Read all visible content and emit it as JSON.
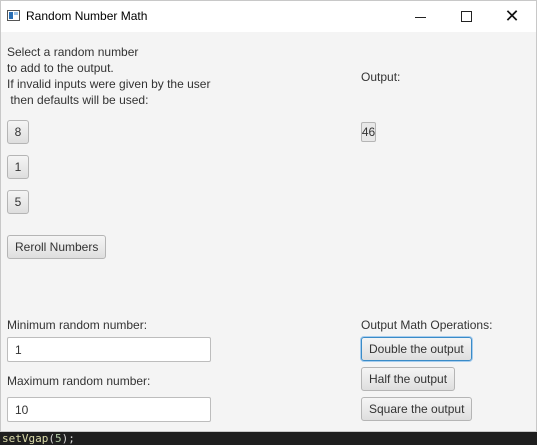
{
  "window": {
    "title": "Random Number Math",
    "controls": {
      "minimize": "",
      "maximize": "",
      "close": "✕"
    }
  },
  "left_panel": {
    "instructions": "Select a random number\nto add to the output.\nIf invalid inputs were given by the user\n then defaults will be used:",
    "number_buttons": [
      "8",
      "1",
      "5"
    ],
    "reroll_label": "Reroll Numbers",
    "min_label": "Minimum random number:",
    "min_value": "1",
    "max_label": "Maximum random number:",
    "max_value": "10"
  },
  "right_panel": {
    "output_label": "Output:",
    "output_value": "46",
    "operations_label": "Output Math Operations:",
    "operations": [
      "Double the output",
      "Half the output",
      "Square the output"
    ],
    "focused_operation": "Double the output"
  },
  "code_editor_strip": {
    "function": "setVgap",
    "open_paren": "(",
    "argument": "5",
    "close": ");"
  },
  "colors": {
    "window_bg": "#f4f4f4",
    "focus_border": "#3a8bc7",
    "editor_bg": "#1e1e1e"
  },
  "icons": [
    "app-icon",
    "minimize-icon",
    "maximize-icon",
    "close-icon"
  ]
}
